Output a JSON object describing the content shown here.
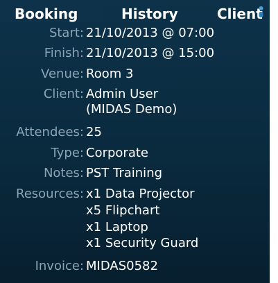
{
  "tabs": {
    "booking": "Booking",
    "history": "History",
    "client": "Client"
  },
  "colors": {
    "panel_background": "#0a2a3e",
    "label_text": "#8ba5b7",
    "value_text": "#ffffff",
    "client_indicator": "#4aa0d8"
  },
  "icons": {
    "client_tab": "client-person-icon"
  },
  "booking": {
    "start": {
      "label": "Start:",
      "value": "21/10/2013 @ 07:00"
    },
    "finish": {
      "label": "Finish:",
      "value": "21/10/2013 @ 15:00"
    },
    "venue": {
      "label": "Venue:",
      "value": "Room 3"
    },
    "client": {
      "label": "Client:",
      "value_line1": "Admin User",
      "value_line2": "(MIDAS Demo)"
    },
    "attendees": {
      "label": "Attendees:",
      "value": "25"
    },
    "type": {
      "label": "Type:",
      "value": "Corporate"
    },
    "notes": {
      "label": "Notes:",
      "value": "PST Training"
    },
    "resources": {
      "label": "Resources:",
      "items": [
        "x1 Data Projector",
        "x5 Flipchart",
        "x1 Laptop",
        "x1 Security Guard"
      ]
    },
    "invoice": {
      "label": "Invoice:",
      "value": "MIDAS0582"
    }
  }
}
